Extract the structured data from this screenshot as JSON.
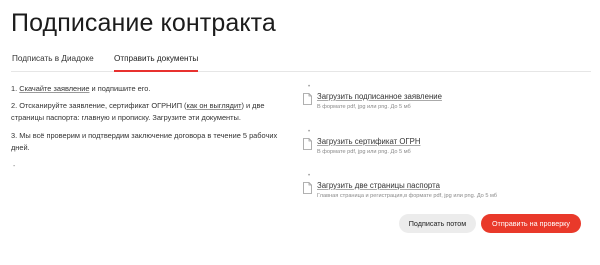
{
  "page": {
    "title": "Подписание контракта"
  },
  "tabs": [
    {
      "label": "Подписать в Диадоке",
      "active": false
    },
    {
      "label": "Отправить документы",
      "active": true
    }
  ],
  "steps": {
    "s1": {
      "number": "1.",
      "link": "Скачайте заявление",
      "rest": " и подпишите его."
    },
    "s2": {
      "before": "2. Отсканируйте заявление, сертификат ОГРНИП (",
      "link": "как он выглядит",
      "after": ") и две страницы паспорта: главную и прописку. Загрузите эти документы."
    },
    "s3": {
      "text": "3. Мы всё проверим и подтвердим заключение договора в течение 5 рабочих дней."
    },
    "dash": "-"
  },
  "uploads": [
    {
      "dot": "•",
      "title": "Загрузить подписанное заявление",
      "hint": "В формате pdf, jpg или png. До 5 мб"
    },
    {
      "dot": "•",
      "title": "Загрузить сертификат ОГРН",
      "hint": "В формате pdf, jpg или png. До 5 мб"
    },
    {
      "dot": "•",
      "title": "Загрузить две страницы паспорта",
      "hint": "Главная страница и регистрация,в формате pdf, jpg или png. До 5 мб"
    }
  ],
  "buttons": {
    "later": "Подписать потом",
    "send": "Отправить на проверку"
  },
  "colors": {
    "accent": "#e9392a",
    "secondary_button": "#ececec"
  },
  "icons": {
    "upload": "document-icon"
  }
}
